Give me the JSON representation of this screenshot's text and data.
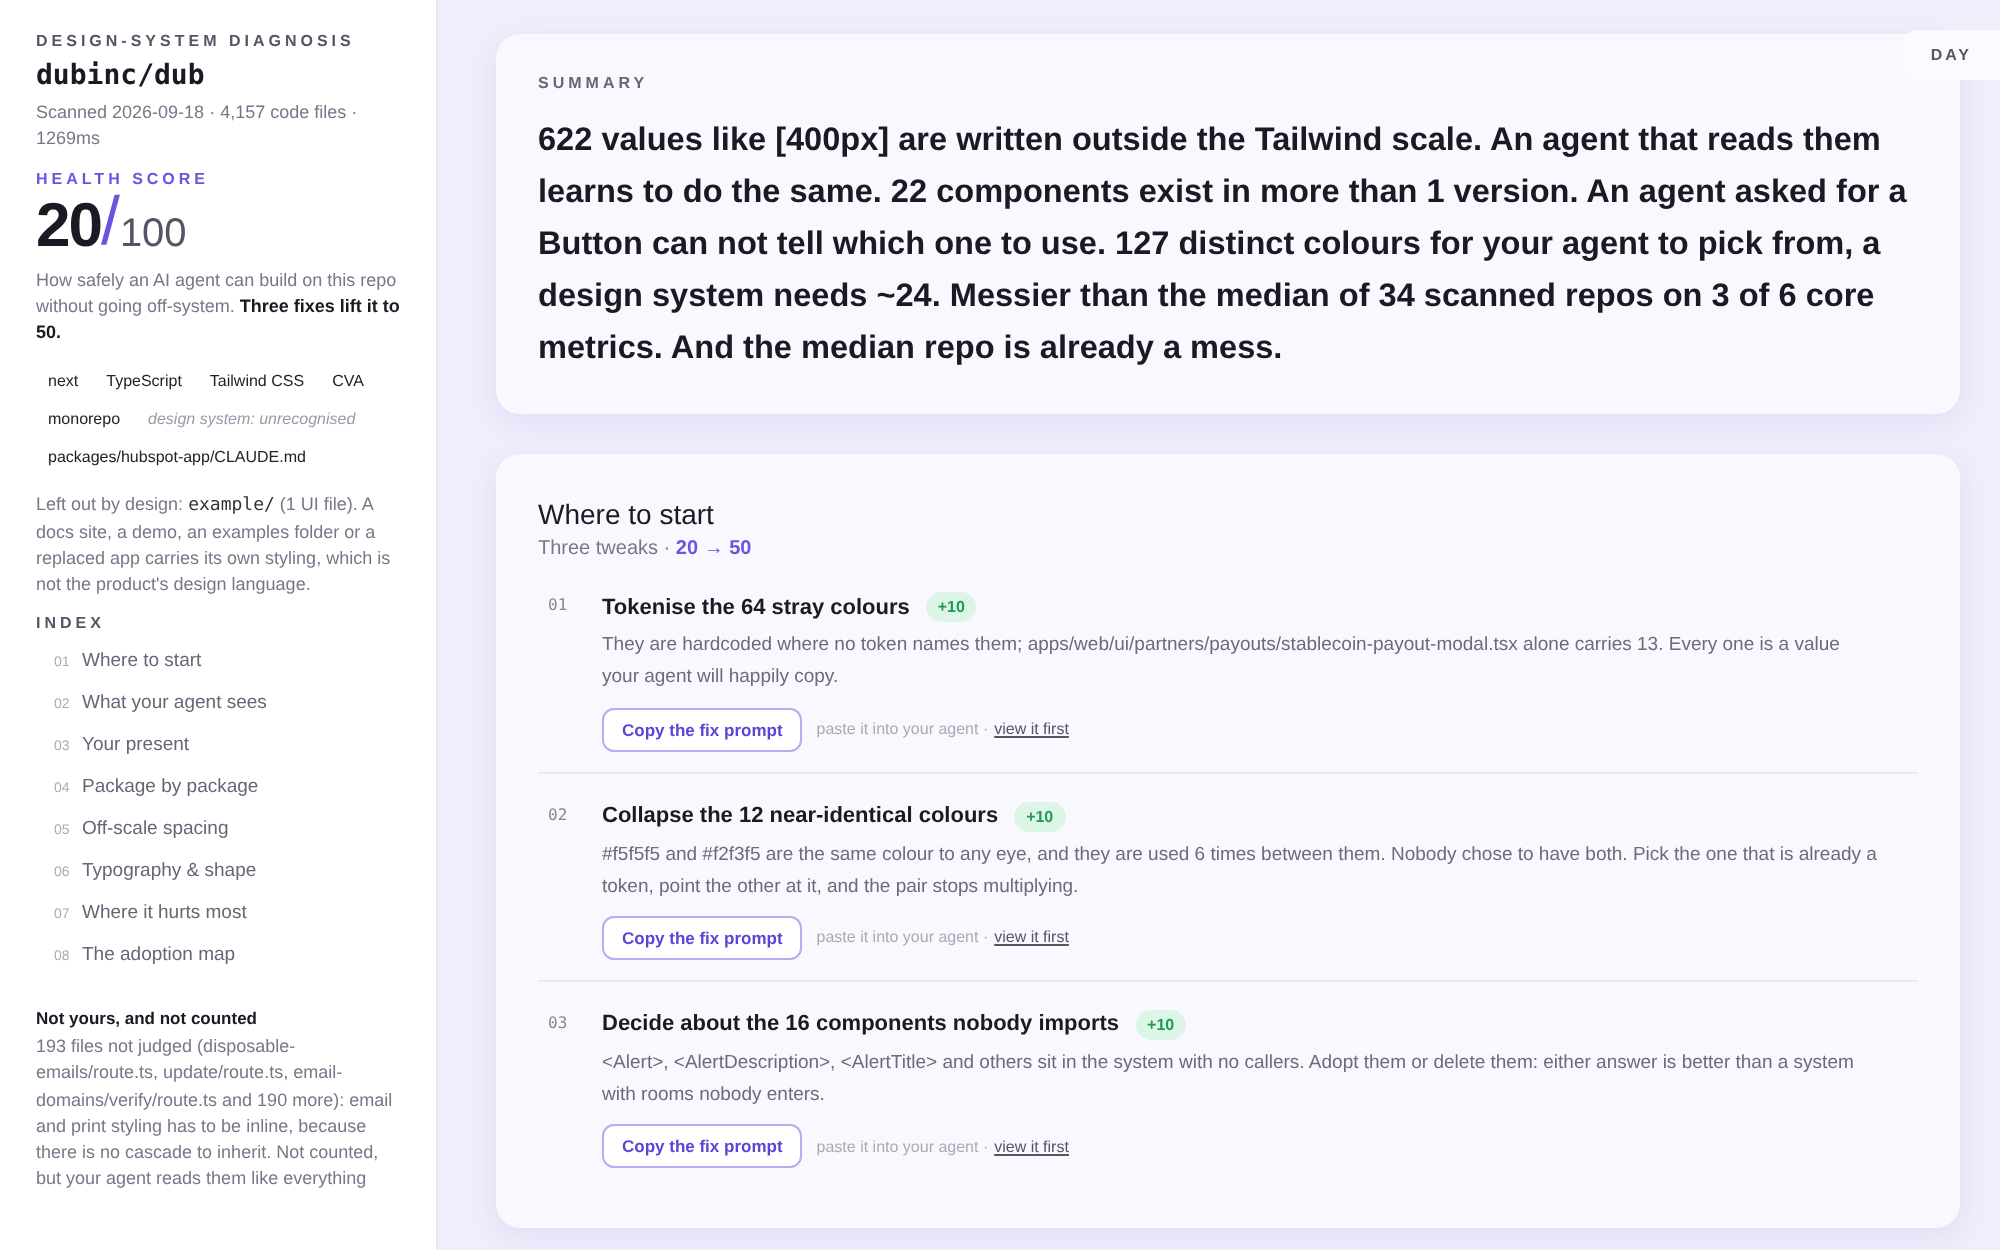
{
  "sidebar": {
    "eyebrow": "DESIGN-SYSTEM DIAGNOSIS",
    "repo": "dubinc/dub",
    "scan_info": "Scanned 2026-09-18 · 4,157 code files · 1269ms",
    "health": {
      "label": "HEALTH SCORE",
      "score": "20",
      "slash": "/",
      "max": "100",
      "description": "How safely an AI agent can build on this repo without going off-system. **Three fixes lift it to 50.**"
    },
    "tags": [
      {
        "kind": "tag",
        "text": "next"
      },
      {
        "kind": "tag",
        "text": "TypeScript"
      },
      {
        "kind": "tag",
        "text": "Tailwind CSS"
      },
      {
        "kind": "tag",
        "text": "CVA"
      },
      {
        "kind": "tag",
        "text": "monorepo"
      },
      {
        "kind": "note",
        "text": "design system: unrecognised"
      },
      {
        "kind": "tag",
        "text": "packages/hubspot-app/CLAUDE.md"
      }
    ],
    "left_out": {
      "prefix": "Left out by design:",
      "code": "example/",
      "rest": "(1 UI file). A docs site, a demo, an examples folder or a replaced app carries its own styling, which is not the product's design language."
    },
    "index_title": "INDEX",
    "index": [
      {
        "num": "01",
        "label": "Where to start"
      },
      {
        "num": "02",
        "label": "What your agent sees"
      },
      {
        "num": "03",
        "label": "Your present"
      },
      {
        "num": "04",
        "label": "Package by package"
      },
      {
        "num": "05",
        "label": "Off-scale spacing"
      },
      {
        "num": "06",
        "label": "Typography & shape"
      },
      {
        "num": "07",
        "label": "Where it hurts most"
      },
      {
        "num": "08",
        "label": "The adoption map"
      }
    ],
    "not_counted": {
      "title": "Not yours, and not counted",
      "text": "193 files not judged (disposable-emails/route.ts, update/route.ts, email-domains/verify/route.ts and 190 more): email and print styling has to be inline, because there is no cascade to inherit. Not counted, but your agent reads them like everything"
    }
  },
  "theme_button": "DAY",
  "summary": {
    "label": "SUMMARY",
    "text": "622 values like [400px] are written outside the Tailwind scale. An agent that reads them learns to do the same. 22 components exist in more than 1 version. An agent asked for a Button can not tell which one to use. 127 distinct colours for your agent to pick from, a design system needs ~24. Messier than the median of 34 scanned repos on 3 of 6 core metrics. And the median repo is already a mess."
  },
  "start": {
    "title": "Where to start",
    "subtitle": "Three tweaks · **20 → 50**",
    "fixes": [
      {
        "num": "01",
        "title": "Tokenise the 64 stray colours",
        "gain": "+10",
        "text": "They are hardcoded where no token names them; apps/web/ui/partners/payouts/stablecoin-payout-modal.tsx alone carries 13. Every one is a value your agent will happily copy.",
        "button": "Copy the fix prompt",
        "hint": "paste it into your agent ·",
        "link": "view it first"
      },
      {
        "num": "02",
        "title": "Collapse the 12 near-identical colours",
        "gain": "+10",
        "text": "#f5f5f5 and #f2f3f5 are the same colour to any eye, and they are used 6 times between them. Nobody chose to have both. Pick the one that is already a token, point the other at it, and the pair stops multiplying.",
        "button": "Copy the fix prompt",
        "hint": "paste it into your agent ·",
        "link": "view it first"
      },
      {
        "num": "03",
        "title": "Decide about the 16 components nobody imports",
        "gain": "+10",
        "text": "<Alert>, <AlertDescription>, <AlertTitle> and others sit in the system with no callers. Adopt them or delete them: either answer is better than a system with rooms nobody enters.",
        "button": "Copy the fix prompt",
        "hint": "paste it into your agent ·",
        "link": "view it first"
      }
    ]
  }
}
